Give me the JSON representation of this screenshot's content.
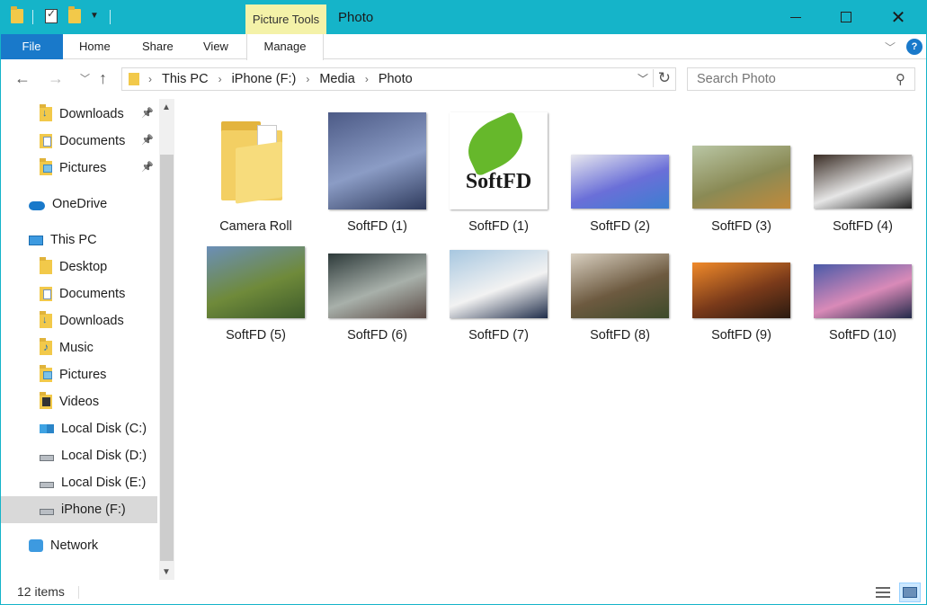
{
  "window": {
    "title": "Photo",
    "contextual_tab": "Picture Tools"
  },
  "ribbon": {
    "tabs": [
      {
        "label": "File"
      },
      {
        "label": "Home"
      },
      {
        "label": "Share"
      },
      {
        "label": "View"
      },
      {
        "label": "Manage"
      }
    ]
  },
  "address": {
    "crumbs": [
      "This PC",
      "iPhone (F:)",
      "Media",
      "Photo"
    ]
  },
  "search": {
    "placeholder": "Search Photo"
  },
  "navpane": {
    "items": [
      {
        "label": "Downloads",
        "icon": "downloads-folder-icon",
        "pinned": true
      },
      {
        "label": "Documents",
        "icon": "documents-folder-icon",
        "pinned": true
      },
      {
        "label": "Pictures",
        "icon": "pictures-folder-icon",
        "pinned": true
      },
      {
        "label": "OneDrive",
        "icon": "onedrive-icon"
      },
      {
        "label": "This PC",
        "icon": "this-pc-icon"
      },
      {
        "label": "Desktop",
        "icon": "desktop-folder-icon"
      },
      {
        "label": "Documents",
        "icon": "documents-folder-icon"
      },
      {
        "label": "Downloads",
        "icon": "downloads-folder-icon"
      },
      {
        "label": "Music",
        "icon": "music-folder-icon"
      },
      {
        "label": "Pictures",
        "icon": "pictures-folder-icon"
      },
      {
        "label": "Videos",
        "icon": "videos-folder-icon"
      },
      {
        "label": "Local Disk (C:)",
        "icon": "windows-disk-icon"
      },
      {
        "label": "Local Disk (D:)",
        "icon": "disk-icon"
      },
      {
        "label": "Local Disk (E:)",
        "icon": "disk-icon"
      },
      {
        "label": "iPhone (F:)",
        "icon": "disk-icon",
        "selected": true
      },
      {
        "label": "Network",
        "icon": "network-icon"
      }
    ]
  },
  "files": [
    {
      "name": "Camera Roll",
      "kind": "folder"
    },
    {
      "name": "SoftFD (1)",
      "kind": "photo",
      "colors": [
        "#4c5a86",
        "#8b9cc5",
        "#2e3a5c"
      ]
    },
    {
      "name": "SoftFD (1)",
      "kind": "logo",
      "colors": [
        "#ffffff",
        "#66b82b",
        "#1a1a1a"
      ]
    },
    {
      "name": "SoftFD (2)",
      "kind": "photo",
      "colors": [
        "#e8e8ee",
        "#6a6fd8",
        "#3b7fd0"
      ]
    },
    {
      "name": "SoftFD (3)",
      "kind": "photo",
      "colors": [
        "#b9c6a4",
        "#8a8a55",
        "#c28a3a"
      ]
    },
    {
      "name": "SoftFD (4)",
      "kind": "photo",
      "colors": [
        "#3a2d25",
        "#e6e6e6",
        "#222222"
      ]
    },
    {
      "name": "SoftFD (5)",
      "kind": "photo",
      "colors": [
        "#6b8fb8",
        "#6f8a3a",
        "#3d5a2a"
      ]
    },
    {
      "name": "SoftFD (6)",
      "kind": "photo",
      "colors": [
        "#2d3a3a",
        "#a8b0aa",
        "#5a4a44"
      ]
    },
    {
      "name": "SoftFD (7)",
      "kind": "photo",
      "colors": [
        "#a7c7e0",
        "#f2f2f2",
        "#1f2d4a"
      ]
    },
    {
      "name": "SoftFD (8)",
      "kind": "photo",
      "colors": [
        "#d8cfc0",
        "#6d5a40",
        "#3c4a2a"
      ]
    },
    {
      "name": "SoftFD (9)",
      "kind": "photo",
      "colors": [
        "#f08a2a",
        "#7a3a1a",
        "#2a1a10"
      ]
    },
    {
      "name": "SoftFD (10)",
      "kind": "photo",
      "colors": [
        "#4a5aa8",
        "#d98ab8",
        "#222a4a"
      ]
    }
  ],
  "status": {
    "item_count": "12 items"
  },
  "colors": {
    "accent": "#15b4c9",
    "file_tab": "#1979ca",
    "context_tab": "#f4f2a8"
  }
}
